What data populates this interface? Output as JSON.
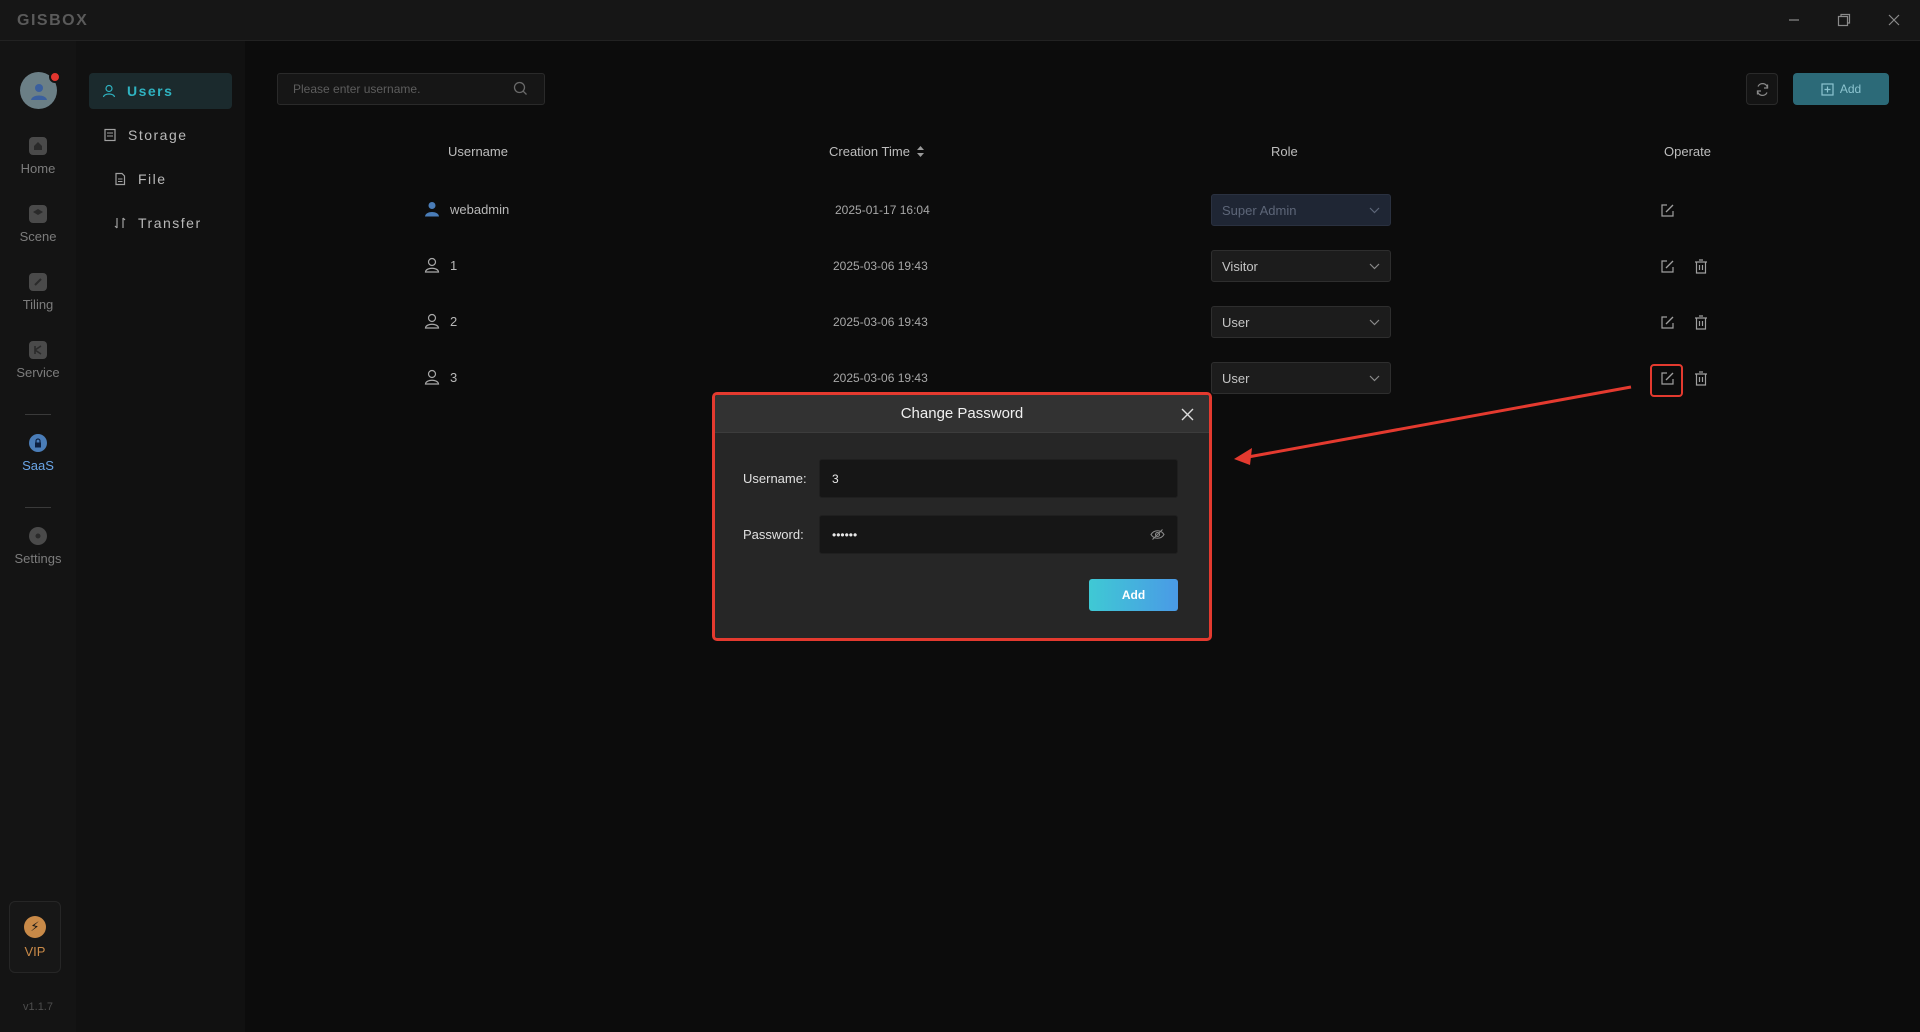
{
  "app": {
    "logo": "GISBOX",
    "version": "v1.1.7"
  },
  "rail": {
    "items": [
      {
        "label": "Home",
        "icon": "home-icon"
      },
      {
        "label": "Scene",
        "icon": "scene-icon"
      },
      {
        "label": "Tiling",
        "icon": "tiling-icon"
      },
      {
        "label": "Service",
        "icon": "service-icon"
      },
      {
        "label": "SaaS",
        "icon": "lock-icon"
      },
      {
        "label": "Settings",
        "icon": "gear-icon"
      }
    ],
    "vip_label": "VIP"
  },
  "subnav": {
    "items": [
      {
        "label": "Users"
      },
      {
        "label": "Storage"
      },
      {
        "label": "File"
      },
      {
        "label": "Transfer"
      }
    ]
  },
  "toolbar": {
    "search_placeholder": "Please enter username.",
    "add_label": "Add"
  },
  "table": {
    "headers": {
      "username": "Username",
      "creation_time": "Creation Time",
      "role": "Role",
      "operate": "Operate"
    },
    "rows": [
      {
        "username": "webadmin",
        "time": "2025-01-17 16:04",
        "role": "Super Admin"
      },
      {
        "username": "1",
        "time": "2025-03-06 19:43",
        "role": "Visitor"
      },
      {
        "username": "2",
        "time": "2025-03-06 19:43",
        "role": "User"
      },
      {
        "username": "3",
        "time": "2025-03-06 19:43",
        "role": "User"
      }
    ]
  },
  "modal": {
    "title": "Change Password",
    "username_label": "Username:",
    "username_value": "3",
    "password_label": "Password:",
    "password_value": "••••••",
    "submit_label": "Add"
  },
  "colors": {
    "accent": "#2fb3c1",
    "annotation": "#e43a2f",
    "admin_icon": "#4a7db8"
  }
}
